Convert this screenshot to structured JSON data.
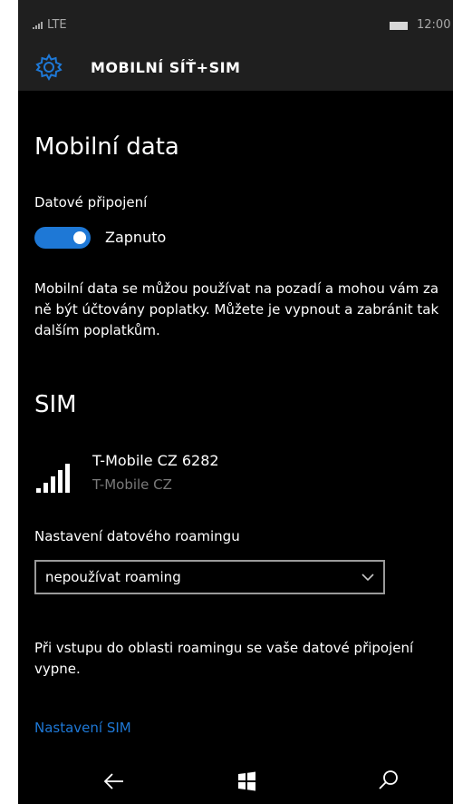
{
  "status_bar": {
    "network": "LTE",
    "time": "12:00",
    "icons": [
      "signal-icon",
      "battery-icon"
    ]
  },
  "header": {
    "title": "MOBILNÍ SÍŤ+SIM",
    "icon": "gear-icon"
  },
  "mobile_data": {
    "heading": "Mobilní data",
    "toggle_label": "Datové připojení",
    "toggle_state": "Zapnuto",
    "toggle_on": true,
    "description": "Mobilní data se můžou používat na pozadí a mohou vám za ně být účtovány poplatky. Můžete je vypnout a zabránit tak dalším poplatkům."
  },
  "sim": {
    "heading": "SIM",
    "carrier_name": "T-Mobile CZ 6282",
    "carrier_sub": "T-Mobile CZ",
    "roaming_label": "Nastavení datového roamingu",
    "roaming_value": "nepoužívat roaming",
    "roaming_note": "Při vstupu do oblasti roamingu se vaše datové připojení vypne.",
    "sim_settings_link": "Nastavení SIM"
  },
  "nav_bar": {
    "items": [
      "back-arrow-icon",
      "windows-logo-icon",
      "search-icon"
    ]
  },
  "colors": {
    "accent": "#1e78d6",
    "background": "#000000",
    "bar_background": "#1f1f1f",
    "brand_mark": "#e20074"
  }
}
